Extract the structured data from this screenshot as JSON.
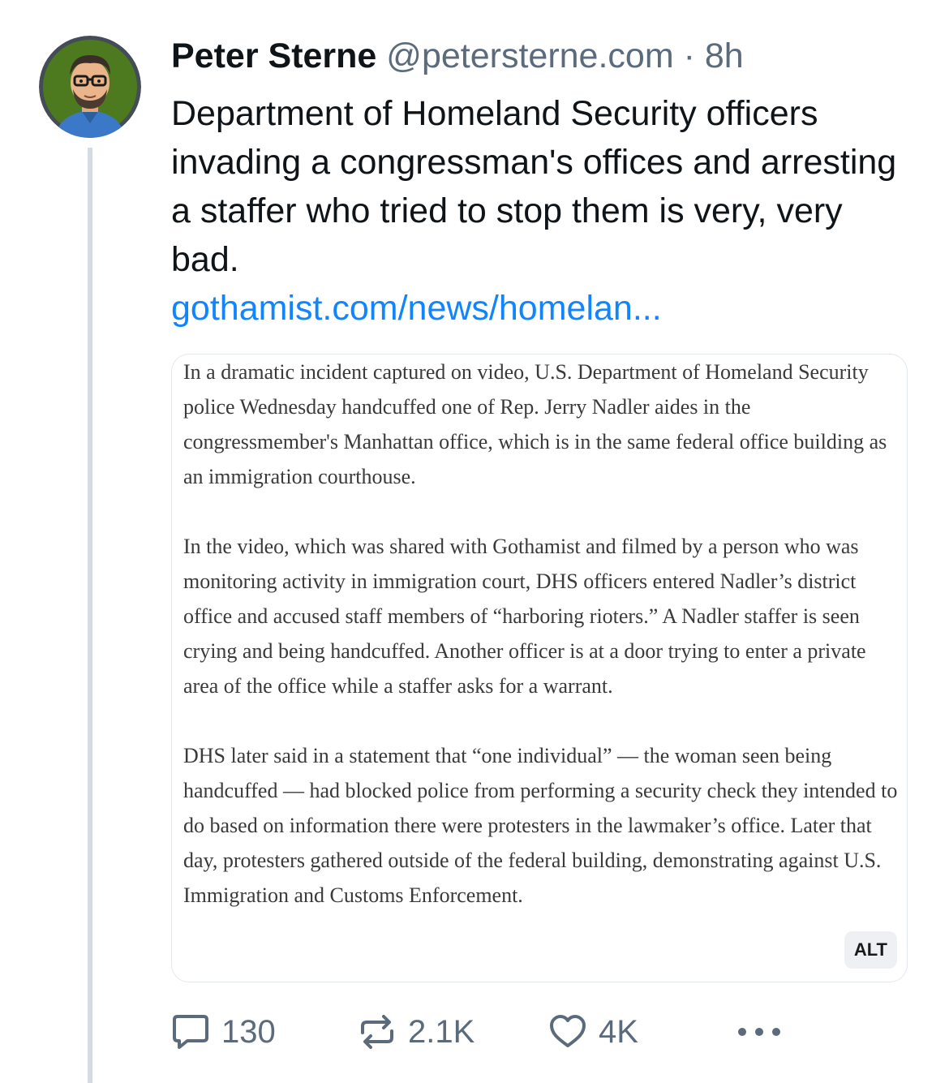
{
  "post": {
    "author": {
      "display_name": "Peter Sterne",
      "handle": "@petersterne.com",
      "separator": "·",
      "time": "8h"
    },
    "text": "Department of Homeland Security officers invading a congressman's offices and arresting a staffer who tried to stop them is very, very bad.",
    "link_text": "gothamist.com/news/homelan...",
    "embed": {
      "paragraphs": [
        "In a dramatic incident captured on video, U.S. Department of Homeland Security police Wednesday handcuffed one of Rep. Jerry Nadler aides in the congressmember's Manhattan office, which is in the same federal office building as an immigration courthouse.",
        "In the video, which was shared with Gothamist and filmed by a person who was monitoring activity in immigration court, DHS officers entered Nadler’s district office and accused staff members of “harboring rioters.” A Nadler staffer is seen crying and being handcuffed. Another officer is at a door trying to enter a private area of the office while a staffer asks for a warrant.",
        "DHS later said in a statement that “one individual” — the woman seen being handcuffed — had blocked police from performing a security check they intended to do based on information there were protesters in the lawmaker’s office. Later that day, protesters gathered outside of the federal building, demonstrating against U.S. Immigration and Customs Enforcement."
      ],
      "alt_badge": "ALT"
    },
    "actions": {
      "replies": "130",
      "reposts": "2.1K",
      "likes": "4K"
    },
    "icons": {
      "reply": "speech-bubble-icon",
      "repost": "repost-arrows-icon",
      "like": "heart-icon",
      "more": "more-dots-icon"
    },
    "colors": {
      "link": "#1185fe",
      "muted": "#5b6b7c",
      "text": "#0f1419",
      "thread_line": "#d4dbe3"
    }
  }
}
